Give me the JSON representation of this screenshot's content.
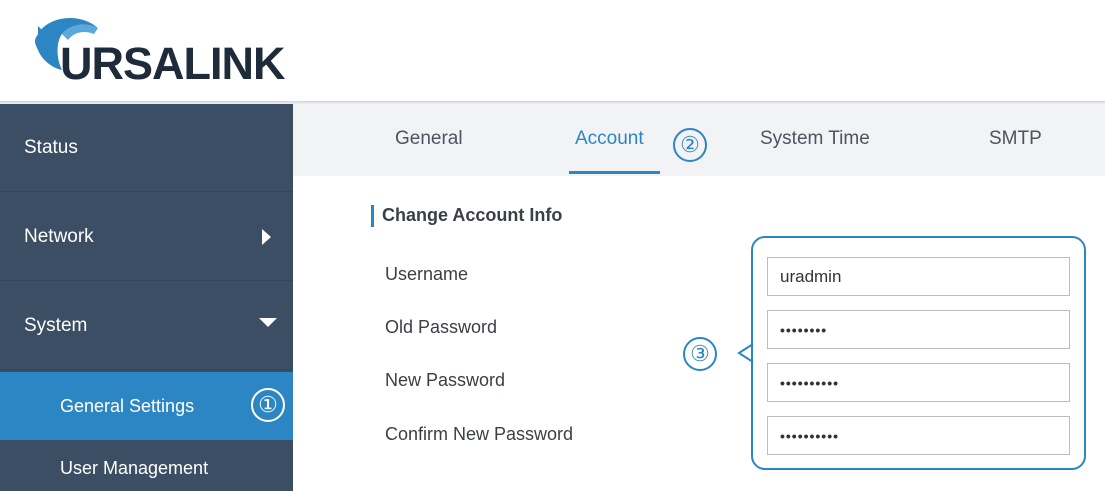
{
  "brand": {
    "name": "URSALINK",
    "accent": "#2d86c4",
    "sidebar_bg": "#3b4e63"
  },
  "sidebar": {
    "items": [
      {
        "label": "Status",
        "icon": ""
      },
      {
        "label": "Network",
        "icon": "caret-right-icon"
      },
      {
        "label": "System",
        "icon": "caret-down-icon"
      }
    ],
    "sub_items": [
      {
        "label": "General Settings",
        "active": true,
        "marker": "①"
      },
      {
        "label": "User Management",
        "active": false
      }
    ]
  },
  "tabs": {
    "items": [
      {
        "label": "General"
      },
      {
        "label": "Account",
        "active": true,
        "marker": "②"
      },
      {
        "label": "System Time"
      },
      {
        "label": "SMTP"
      }
    ]
  },
  "section": {
    "title": "Change Account Info",
    "marker": "③",
    "fields": [
      {
        "label": "Username",
        "value": "uradmin"
      },
      {
        "label": "Old Password",
        "value": "••••••••"
      },
      {
        "label": "New Password",
        "value": "••••••••••"
      },
      {
        "label": "Confirm New Password",
        "value": "••••••••••"
      }
    ]
  }
}
